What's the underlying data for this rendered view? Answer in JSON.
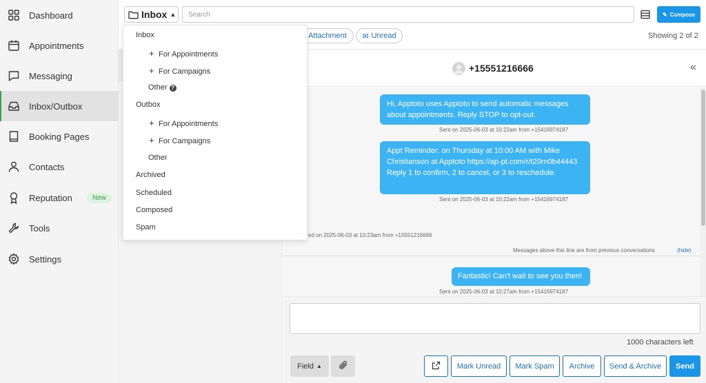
{
  "sidebar": {
    "items": [
      {
        "label": "Dashboard",
        "icon": "grid-icon"
      },
      {
        "label": "Appointments",
        "icon": "calendar-icon"
      },
      {
        "label": "Messaging",
        "icon": "chat-icon"
      },
      {
        "label": "Inbox/Outbox",
        "icon": "inbox-icon"
      },
      {
        "label": "Booking Pages",
        "icon": "book-icon"
      },
      {
        "label": "Contacts",
        "icon": "person-icon"
      },
      {
        "label": "Reputation",
        "icon": "award-icon",
        "badge": "New"
      },
      {
        "label": "Tools",
        "icon": "wrench-icon"
      },
      {
        "label": "Settings",
        "icon": "gear-icon"
      }
    ]
  },
  "toolbar": {
    "folder_label": "Inbox",
    "search_placeholder": "Search",
    "compose_label": "Compose"
  },
  "filters": {
    "attachment_label": "Attachment",
    "unread_label": "Unread",
    "showing_text": "Showing 2 of 2"
  },
  "dropdown": {
    "inbox": "Inbox",
    "inbox_for_appointments": "For Appointments",
    "inbox_for_campaigns": "For Campaigns",
    "inbox_other": "Other",
    "outbox": "Outbox",
    "outbox_for_appointments": "For Appointments",
    "outbox_for_campaigns": "For Campaigns",
    "outbox_other": "Other",
    "archived": "Archived",
    "scheduled": "Scheduled",
    "composed": "Composed",
    "spam": "Spam"
  },
  "conversation": {
    "phone": "+15551216666",
    "messages": [
      {
        "text": "Hi, Apptoto uses Apptoto to send automatic messages about appointments. Reply STOP to opt-out.",
        "meta": "Sent on 2025-06-03 at 10:22am from +15416974187"
      },
      {
        "text": "Appt Reminder: on Thursday at 10:00 AM with Mike Christianson at Apptoto https://ap-pt.com/r/t20rn0b44443 Reply 1 to confirm, 2 to cancel, or 3 to reschedule.",
        "meta": "Sent on 2025-06-03 at 10:22am from +15416974187"
      },
      {
        "text": "",
        "meta": "ed on 2025-06-03 at 10:23am from +15551216666"
      },
      {
        "text": "Fantastic! Can't wait to see you then!",
        "meta": "Sent on 2025-06-03 at 10:27am from +15416974187"
      }
    ],
    "divider_text": "Messages above this line are from previous conversations",
    "hide_label": "(hide)"
  },
  "composer": {
    "chars_left": "1000 characters left",
    "field_label": "Field",
    "mark_unread": "Mark Unread",
    "mark_spam": "Mark Spam",
    "archive": "Archive",
    "send_archive": "Send & Archive",
    "send": "Send"
  },
  "colors": {
    "accent": "#1a96e8",
    "bubble": "#3cb4f4",
    "link": "#1a73c2",
    "active_marker": "#3aa34a"
  }
}
